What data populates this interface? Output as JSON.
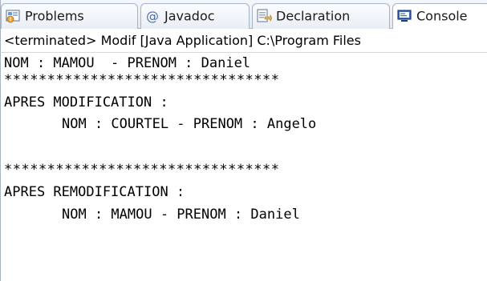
{
  "tabs": [
    {
      "label": "Problems",
      "icon": "problems-icon"
    },
    {
      "label": "Javadoc",
      "icon": "at-sign-icon"
    },
    {
      "label": "Declaration",
      "icon": "declaration-icon"
    },
    {
      "label": "Console",
      "icon": "console-icon"
    }
  ],
  "active_tab": "Console",
  "console": {
    "status": "<terminated> Modif [Java Application] C:\\Program Files",
    "lines": [
      "NOM : MAMOU  - PRENOM : Daniel",
      "********************************",
      "APRES MODIFICATION :",
      "NOM : COURTEL - PRENOM : Angelo",
      "********************************",
      "APRES REMODIFICATION :",
      "NOM : MAMOU - PRENOM : Daniel"
    ]
  },
  "colors": {
    "tab_border": "#a8b3c4",
    "tab_bg": "#e9eef5",
    "console_bg": "#ffffff",
    "text": "#000000"
  }
}
